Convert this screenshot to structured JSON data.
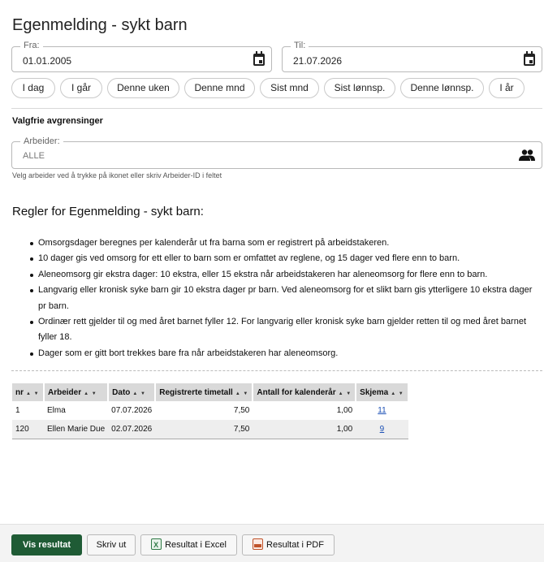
{
  "title": "Egenmelding - sykt barn",
  "date_from": {
    "label": "Fra:",
    "value": "01.01.2005",
    "icon": "calendar-icon"
  },
  "date_to": {
    "label": "Til:",
    "value": "21.07.2026",
    "icon": "calendar-icon"
  },
  "quick_ranges": [
    "I dag",
    "I går",
    "Denne uken",
    "Denne mnd",
    "Sist mnd",
    "Sist lønnsp.",
    "Denne lønnsp.",
    "I år"
  ],
  "filters": {
    "heading": "Valgfrie avgrensinger",
    "worker_label": "Arbeider:",
    "worker_value": "ALLE",
    "worker_icon": "people-icon",
    "hint": "Velg arbeider ved å trykke på ikonet eller skriv Arbeider-ID i feltet"
  },
  "rules": {
    "title": "Regler for Egenmelding - sykt barn:",
    "items": [
      "Omsorgsdager beregnes per kalenderår ut fra barna som er registrert på arbeidstakeren.",
      "10 dager gis ved omsorg for ett eller to barn som er omfattet av reglene, og 15 dager ved flere enn to barn.",
      "Aleneomsorg gir ekstra dager: 10 ekstra, eller 15 ekstra når arbeidstakeren har aleneomsorg for flere enn to barn.",
      "Langvarig eller kronisk syke barn gir 10 ekstra dager pr barn. Ved aleneomsorg for et slikt barn gis ytterligere 10 ekstra dager pr barn.",
      "Ordinær rett gjelder til og med året barnet fyller 12. For langvarig eller kronisk syke barn gjelder retten til og med året barnet fyller 18.",
      "Dager som er gitt bort trekkes bare fra når arbeidstakeren har aleneomsorg."
    ]
  },
  "table": {
    "columns": [
      "nr",
      "Arbeider",
      "Dato",
      "Registrerte timetall",
      "Antall for kalenderår",
      "Skjema"
    ],
    "sort_glyph": "▲ ▼",
    "rows": [
      [
        "1",
        "Elma",
        "07.07.2026",
        "7,50",
        "1,00",
        "11"
      ],
      [
        "120",
        "Ellen Marie Due",
        "02.07.2026",
        "7,50",
        "1,00",
        "9"
      ]
    ]
  },
  "footer": {
    "show_results": "Vis resultat",
    "print": "Skriv ut",
    "excel": "Resultat i Excel",
    "pdf": "Resultat i PDF"
  },
  "colors": {
    "primary_button": "#1f5b35",
    "link": "#1a4fb5",
    "header_bg": "#d9d9d9"
  }
}
